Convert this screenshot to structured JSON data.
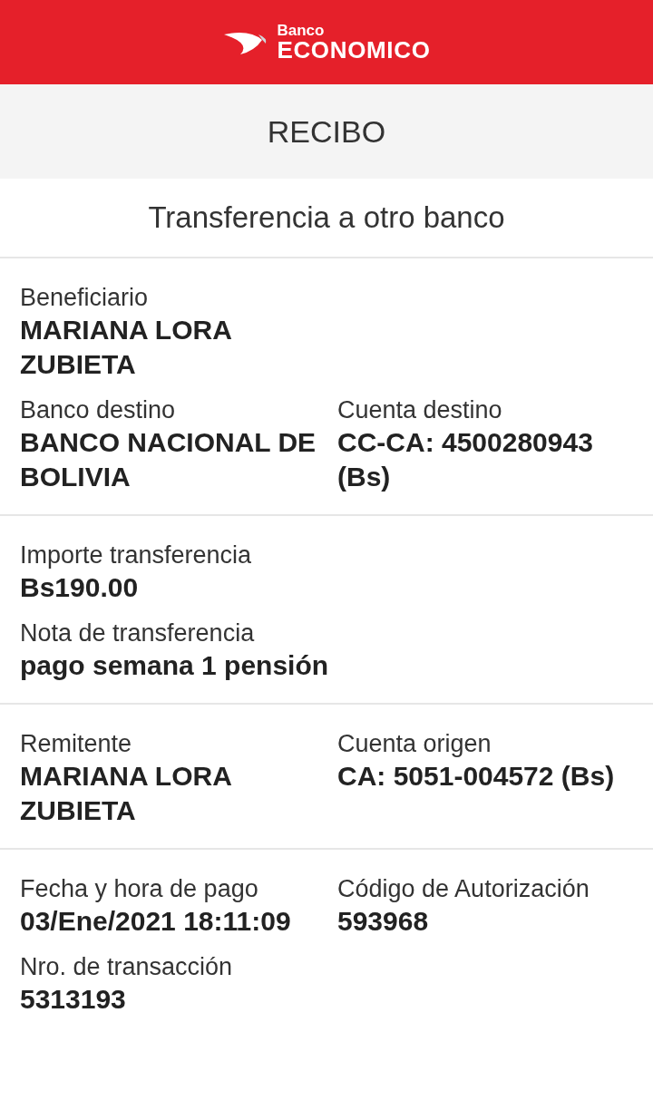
{
  "header": {
    "brand_top": "Banco",
    "brand_name": "ECONOMICO"
  },
  "title": "RECIBO",
  "subtitle": "Transferencia a otro banco",
  "sections": [
    {
      "rows": [
        [
          {
            "label": "Beneficiario",
            "value": "MARIANA LORA ZUBIETA"
          }
        ],
        [
          {
            "label": "Banco destino",
            "value": "BANCO NACIONAL DE BOLIVIA"
          },
          {
            "label": "Cuenta destino",
            "value": "CC-CA: 4500280943 (Bs)"
          }
        ]
      ]
    },
    {
      "rows": [
        [
          {
            "label": "Importe transferencia",
            "value": "Bs190.00"
          }
        ],
        [
          {
            "label": "Nota de transferencia",
            "value": "pago semana 1 pensión"
          }
        ]
      ]
    },
    {
      "rows": [
        [
          {
            "label": "Remitente",
            "value": "MARIANA LORA ZUBIETA"
          },
          {
            "label": "Cuenta origen",
            "value": "CA: 5051-004572 (Bs)"
          }
        ]
      ]
    },
    {
      "rows": [
        [
          {
            "label": "Fecha y hora de pago",
            "value": "03/Ene/2021 18:11:09"
          },
          {
            "label": "Código de Autorización",
            "value": "593968"
          }
        ],
        [
          {
            "label": "Nro. de transacción",
            "value": "5313193"
          }
        ]
      ]
    }
  ]
}
